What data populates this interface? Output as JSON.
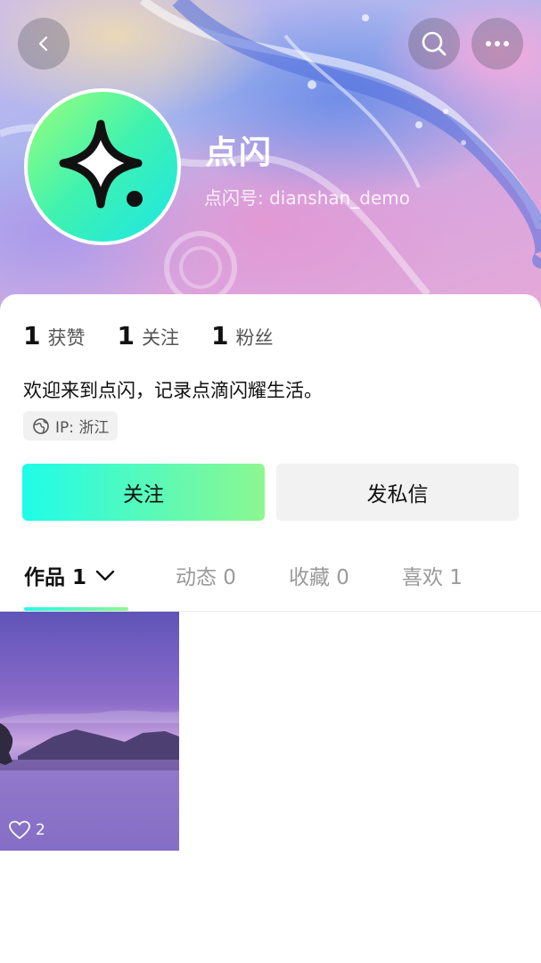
{
  "profile": {
    "name": "点闪",
    "account_id": "点闪号: dianshan_demo",
    "bio": "欢迎来到点闪，记录点滴闪耀生活。",
    "ip_location": "IP: 浙江"
  },
  "stats": [
    {
      "value": "1",
      "label": "获赞"
    },
    {
      "value": "1",
      "label": "关注"
    },
    {
      "value": "1",
      "label": "粉丝"
    }
  ],
  "actions": {
    "follow_label": "关注",
    "message_label": "发私信"
  },
  "tabs": [
    {
      "label": "作品 1",
      "active": true
    },
    {
      "label": "动态 0",
      "active": false
    },
    {
      "label": "收藏 0",
      "active": false
    },
    {
      "label": "喜欢 1",
      "active": false
    }
  ],
  "posts": [
    {
      "likes": "2"
    }
  ],
  "icons": {
    "back": "chevron-left-icon",
    "search": "search-icon",
    "more": "more-horizontal-icon",
    "globe": "globe-icon",
    "heart": "heart-outline-icon",
    "dropdown": "chevron-down-icon"
  },
  "colors": {
    "accent_start": "#1ffce8",
    "accent_end": "#8cf790"
  }
}
